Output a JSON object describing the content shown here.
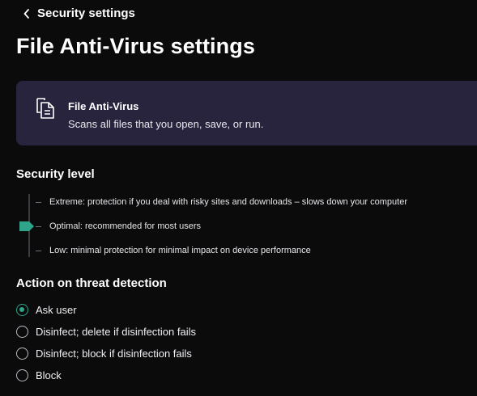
{
  "header": {
    "back_label": "Security settings",
    "title": "File Anti-Virus settings"
  },
  "card": {
    "icon": "file-copy-icon",
    "title": "File Anti-Virus",
    "description": "Scans all files that you open, save, or run."
  },
  "security_level": {
    "title": "Security level",
    "selected": "Optimal",
    "levels": [
      {
        "name": "Extreme:",
        "description": "protection if you deal with risky sites and downloads – slows down your computer"
      },
      {
        "name": "Optimal:",
        "description": "recommended for most users"
      },
      {
        "name": "Low:",
        "description": "minimal protection for minimal impact on device performance"
      }
    ]
  },
  "action": {
    "title": "Action on threat detection",
    "selected": "Ask user",
    "options": [
      {
        "label": "Ask user"
      },
      {
        "label": "Disinfect; delete if disinfection fails"
      },
      {
        "label": "Disinfect; block if disinfection fails"
      },
      {
        "label": "Block"
      }
    ]
  },
  "colors": {
    "background": "#0b0b0c",
    "card": "#29243d",
    "accent": "#2ea58a"
  }
}
